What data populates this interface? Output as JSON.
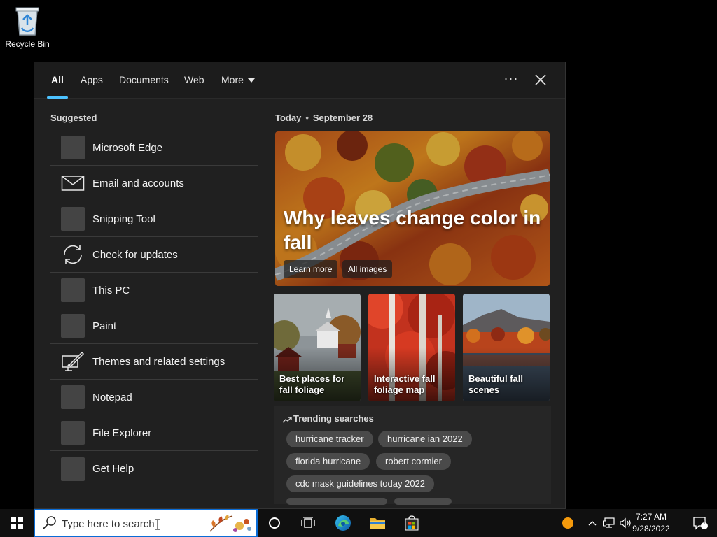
{
  "desktop": {
    "recycle_bin_label": "Recycle Bin"
  },
  "tabs": [
    "All",
    "Apps",
    "Documents",
    "Web",
    "More"
  ],
  "suggested": {
    "title": "Suggested",
    "items": [
      {
        "label": "Microsoft Edge",
        "icon": "edge-app-icon"
      },
      {
        "label": "Email and accounts",
        "icon": "mail-icon"
      },
      {
        "label": "Snipping Tool",
        "icon": "snipping-tool-icon"
      },
      {
        "label": "Check for updates",
        "icon": "sync-icon"
      },
      {
        "label": "This PC",
        "icon": "this-pc-icon"
      },
      {
        "label": "Paint",
        "icon": "paint-icon"
      },
      {
        "label": "Themes and related settings",
        "icon": "brush-icon"
      },
      {
        "label": "Notepad",
        "icon": "notepad-icon"
      },
      {
        "label": "File Explorer",
        "icon": "file-explorer-icon"
      },
      {
        "label": "Get Help",
        "icon": "get-help-icon"
      }
    ]
  },
  "today": {
    "label": "Today",
    "date": "September 28"
  },
  "hero": {
    "title": "Why leaves change color in fall",
    "learn_more": "Learn more",
    "all_images": "All images"
  },
  "cards": [
    {
      "caption": "Best places for fall foliage"
    },
    {
      "caption": "Interactive fall foliage map"
    },
    {
      "caption": "Beautiful fall scenes"
    }
  ],
  "trending": {
    "title": "Trending searches",
    "chips": [
      "hurricane tracker",
      "hurricane ian 2022",
      "florida hurricane",
      "robert cormier",
      "cdc mask guidelines today 2022"
    ]
  },
  "taskbar": {
    "search_placeholder": "Type here to search",
    "time": "7:27 AM",
    "date": "9/28/2022",
    "notification_count": "1"
  },
  "colors": {
    "accent": "#4cc2ff",
    "taskbar": "#101010",
    "panel": "#202020"
  }
}
